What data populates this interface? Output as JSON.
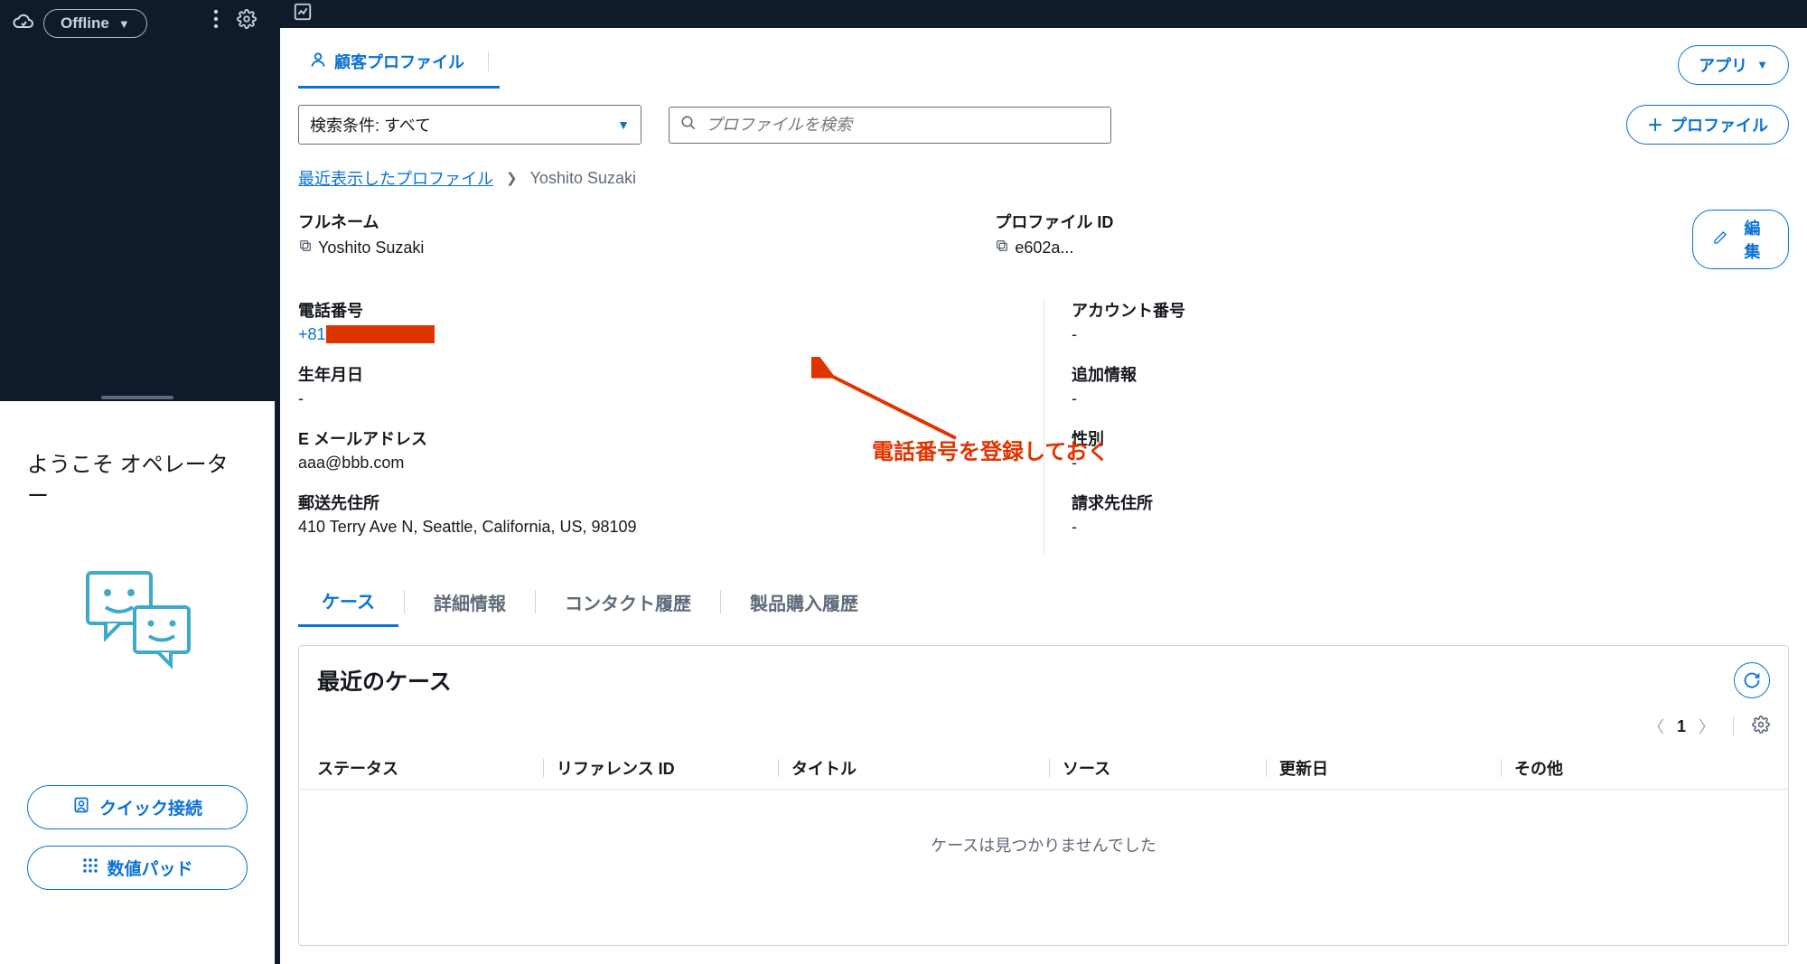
{
  "sidebar": {
    "status": "Offline",
    "welcome": "ようこそ オペレーター",
    "quick_connect": "クイック接続",
    "number_pad": "数値パッド"
  },
  "top": {
    "customer_profile_tab": "顧客プロファイル",
    "apps_button": "アプリ"
  },
  "search": {
    "select_label": "検索条件: すべて",
    "placeholder": "プロファイルを検索",
    "add_profile": "プロファイル"
  },
  "breadcrumb": {
    "recent": "最近表示したプロファイル",
    "current": "Yoshito Suzaki"
  },
  "header": {
    "fullname_label": "フルネーム",
    "fullname_value": "Yoshito Suzaki",
    "profileid_label": "プロファイル ID",
    "profileid_value": "e602a...",
    "edit": "編集"
  },
  "details": {
    "phone_label": "電話番号",
    "phone_prefix": "+81",
    "dob_label": "生年月日",
    "dob_value": "-",
    "email_label": "E メールアドレス",
    "email_value": "aaa@bbb.com",
    "ship_label": "郵送先住所",
    "ship_value": "410 Terry Ave N, Seattle, California, US, 98109",
    "account_label": "アカウント番号",
    "account_value": "-",
    "addinfo_label": "追加情報",
    "addinfo_value": "-",
    "gender_label": "性別",
    "gender_value": "-",
    "billing_label": "請求先住所",
    "billing_value": "-"
  },
  "annotation": "電話番号を登録しておく",
  "lower_tabs": {
    "cases": "ケース",
    "details": "詳細情報",
    "contact_history": "コンタクト履歴",
    "purchase_history": "製品購入履歴"
  },
  "cases": {
    "title": "最近のケース",
    "page": "1",
    "cols": {
      "status": "ステータス",
      "reference": "リファレンス ID",
      "title": "タイトル",
      "source": "ソース",
      "updated": "更新日",
      "other": "その他"
    },
    "empty": "ケースは見つかりませんでした"
  }
}
